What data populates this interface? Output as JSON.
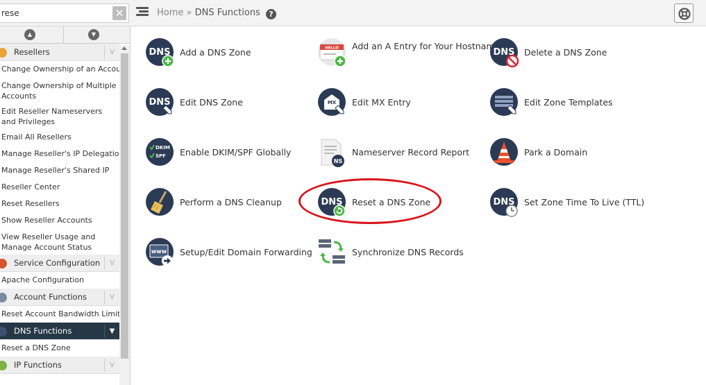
{
  "search": {
    "value": "rese"
  },
  "breadcrumb": {
    "home": "Home",
    "separator": "»",
    "current": "DNS Functions"
  },
  "sidebar": {
    "sections": [
      {
        "label": "Resellers",
        "items": [
          "Change Ownership of an Account",
          "Change Ownership of Multiple Accounts",
          "Edit Reseller Nameservers and Privileges",
          "Email All Resellers",
          "Manage Reseller's IP Delegation",
          "Manage Reseller's Shared IP",
          "Reseller Center",
          "Reset Resellers",
          "Show Reseller Accounts",
          "View Reseller Usage and Manage Account Status"
        ]
      },
      {
        "label": "Service Configuration",
        "items": [
          "Apache Configuration"
        ]
      },
      {
        "label": "Account Functions",
        "items": [
          "Reset Account Bandwidth Limit"
        ]
      },
      {
        "label": "DNS Functions",
        "items": [
          "Reset a DNS Zone"
        ]
      },
      {
        "label": "IP Functions",
        "items": []
      }
    ]
  },
  "main": {
    "functions": [
      {
        "label": "Add a DNS Zone",
        "icon": "dns-add-icon"
      },
      {
        "label": "Add an A Entry for Your Hostname",
        "icon": "hostname-add-icon"
      },
      {
        "label": "Delete a DNS Zone",
        "icon": "dns-delete-icon"
      },
      {
        "label": "Edit DNS Zone",
        "icon": "dns-edit-icon"
      },
      {
        "label": "Edit MX Entry",
        "icon": "mx-edit-icon"
      },
      {
        "label": "Edit Zone Templates",
        "icon": "zone-templates-icon"
      },
      {
        "label": "Enable DKIM/SPF Globally",
        "icon": "dkim-spf-icon"
      },
      {
        "label": "Nameserver Record Report",
        "icon": "ns-report-icon"
      },
      {
        "label": "Park a Domain",
        "icon": "traffic-cone-icon"
      },
      {
        "label": "Perform a DNS Cleanup",
        "icon": "broom-icon"
      },
      {
        "label": "Reset a DNS Zone",
        "icon": "dns-reset-icon"
      },
      {
        "label": "Set Zone Time To Live (TTL)",
        "icon": "dns-ttl-icon"
      },
      {
        "label": "Setup/Edit Domain Forwarding",
        "icon": "www-forward-icon"
      },
      {
        "label": "Synchronize DNS Records",
        "icon": "sync-servers-icon"
      }
    ],
    "icon_text": {
      "dns": "DNS",
      "hello": "HELLO",
      "mx": "MX",
      "ns": "NS",
      "dkim": "DKIM",
      "spf": "SPF",
      "www": "www"
    }
  },
  "colors": {
    "sidebar_active": "#263746",
    "icon_navy": "#2b3a55",
    "plus_green": "#4db848",
    "highlight": "#d9141b"
  }
}
